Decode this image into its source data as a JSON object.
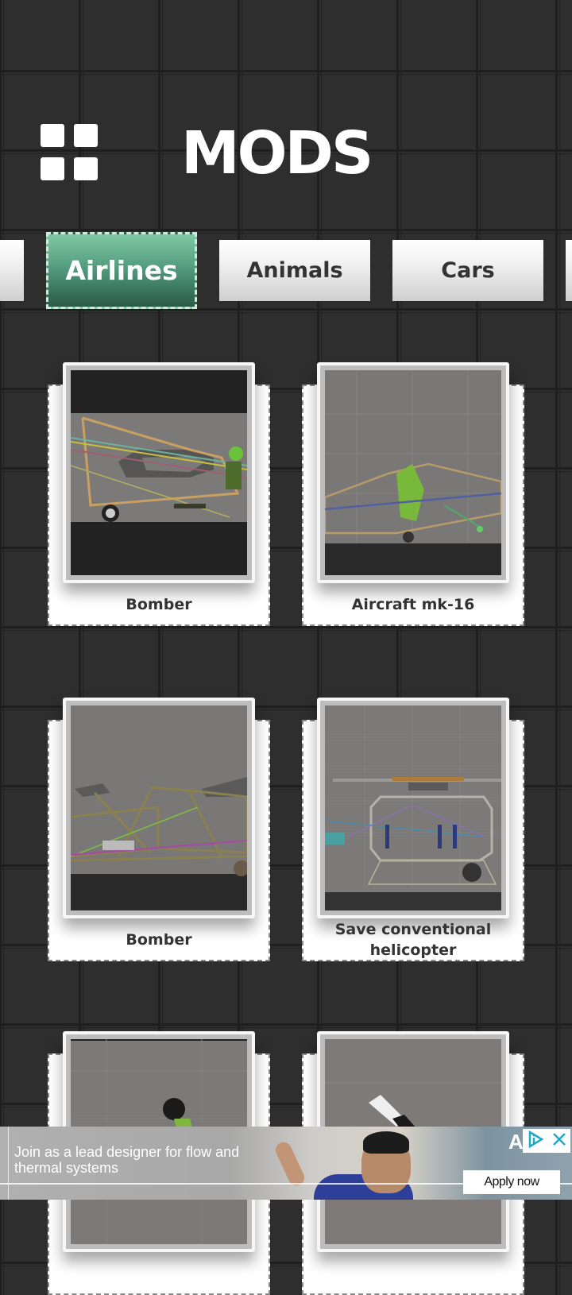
{
  "header": {
    "menu_icon": "grid-menu-icon",
    "title": "MODS"
  },
  "tabs": [
    {
      "label": "",
      "active": false
    },
    {
      "label": "Airlines",
      "active": true
    },
    {
      "label": "Animals",
      "active": false
    },
    {
      "label": "Cars",
      "active": false
    },
    {
      "label": "",
      "active": false
    }
  ],
  "mods": [
    {
      "title": "Bomber",
      "thumbnail": "bomber-biplane-frame"
    },
    {
      "title": "Aircraft mk-16",
      "thumbnail": "aircraft-frame-with-pilot"
    },
    {
      "title": "Bomber",
      "thumbnail": "bomber-truss-frame"
    },
    {
      "title": "Save conventional helicopter",
      "thumbnail": "helicopter-cabin-frame"
    },
    {
      "title": "",
      "thumbnail": "green-figure"
    },
    {
      "title": "",
      "thumbnail": "blade"
    }
  ],
  "ad": {
    "headline": "Join as a lead designer for flow and thermal systems",
    "cta": "Apply now",
    "brand_partial": "A",
    "adchoices_icon": "adchoices-icon",
    "close_icon": "close-icon"
  },
  "colors": {
    "active_tab_top": "#7fcaa4",
    "active_tab_bottom": "#2a5a48",
    "background": "#2e2e2e",
    "adchoices": "#1fa8c9"
  }
}
